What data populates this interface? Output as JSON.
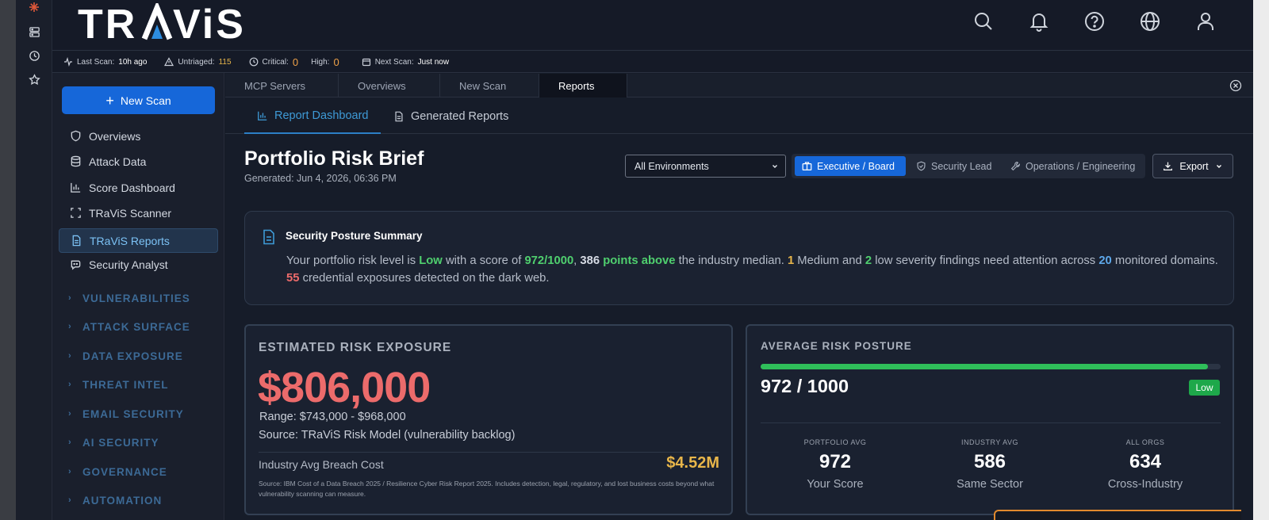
{
  "header": {
    "logo_text": "TRAViS",
    "icons": [
      "search-icon",
      "bell-icon",
      "help-icon",
      "globe-icon",
      "user-icon"
    ]
  },
  "mini_sidebar": {
    "icons": [
      "sparkle-icon",
      "server-icon",
      "clock-icon",
      "star-icon"
    ]
  },
  "status": {
    "last_scan_label": "Last Scan:",
    "last_scan_value": "10h ago",
    "untriaged_label": "Untriaged:",
    "untriaged_value": "115",
    "critical_label": "Critical:",
    "critical_value": "0",
    "high_label": "High:",
    "high_value": "0",
    "next_scan_label": "Next Scan:",
    "next_scan_value": "Just now"
  },
  "sidebar": {
    "new_scan_label": "New Scan",
    "items": [
      {
        "label": "Overviews"
      },
      {
        "label": "Attack Data"
      },
      {
        "label": "Score Dashboard"
      },
      {
        "label": "TRaViS Scanner"
      },
      {
        "label": "TRaViS Reports"
      },
      {
        "label": "Security Analyst"
      }
    ],
    "sections": [
      "VULNERABILITIES",
      "ATTACK SURFACE",
      "DATA EXPOSURE",
      "THREAT INTEL",
      "EMAIL SECURITY",
      "AI SECURITY",
      "GOVERNANCE",
      "AUTOMATION"
    ]
  },
  "tabs": [
    "MCP Servers",
    "Overviews",
    "New Scan",
    "Reports"
  ],
  "subtabs": [
    "Report Dashboard",
    "Generated Reports"
  ],
  "page": {
    "title": "Portfolio Risk Brief",
    "generated": "Generated: Jun 4, 2026, 06:36 PM",
    "environment": "All Environments",
    "views": [
      "Executive / Board",
      "Security Lead",
      "Operations / Engineering"
    ],
    "export_label": "Export"
  },
  "summary": {
    "title": "Security Posture Summary",
    "t1": "Your portfolio risk level is ",
    "level": "Low",
    "t2": " with a score of ",
    "score": "972/1000",
    "t3": ", ",
    "points": "386",
    "points_above": " points above",
    "t4": " the industry median. ",
    "medium_count": "1",
    "t5": " Medium and ",
    "low_count": "2",
    "t6": " low severity findings need attention across ",
    "domains": "20",
    "t7": " monitored domains. ",
    "exposures": "55",
    "t8": " credential exposures detected on the dark web."
  },
  "risk_exposure": {
    "label": "ESTIMATED RISK EXPOSURE",
    "amount": "$806,000",
    "range": "Range: $743,000 - $968,000",
    "source": "Source: TRaViS Risk Model (vulnerability backlog)",
    "breach_label": "Industry Avg Breach Cost",
    "breach_value": "$4.52M",
    "footnote": "Source: IBM Cost of a Data Breach 2025 / Resilience Cyber Risk Report 2025. Includes detection, legal, regulatory, and lost business costs beyond what vulnerability scanning can measure."
  },
  "posture": {
    "label": "AVERAGE RISK POSTURE",
    "score_text": "972 / 1000",
    "progress": 0.972,
    "badge": "Low",
    "stats": [
      {
        "label": "PORTFOLIO AVG",
        "value": "972",
        "sub": "Your Score"
      },
      {
        "label": "INDUSTRY AVG",
        "value": "586",
        "sub": "Same Sector"
      },
      {
        "label": "ALL ORGS",
        "value": "634",
        "sub": "Cross-Industry"
      }
    ]
  },
  "colors": {
    "accent": "#1667d9",
    "danger": "#ec6b6b",
    "warning": "#e8b64a",
    "success": "#2fbf5a"
  }
}
